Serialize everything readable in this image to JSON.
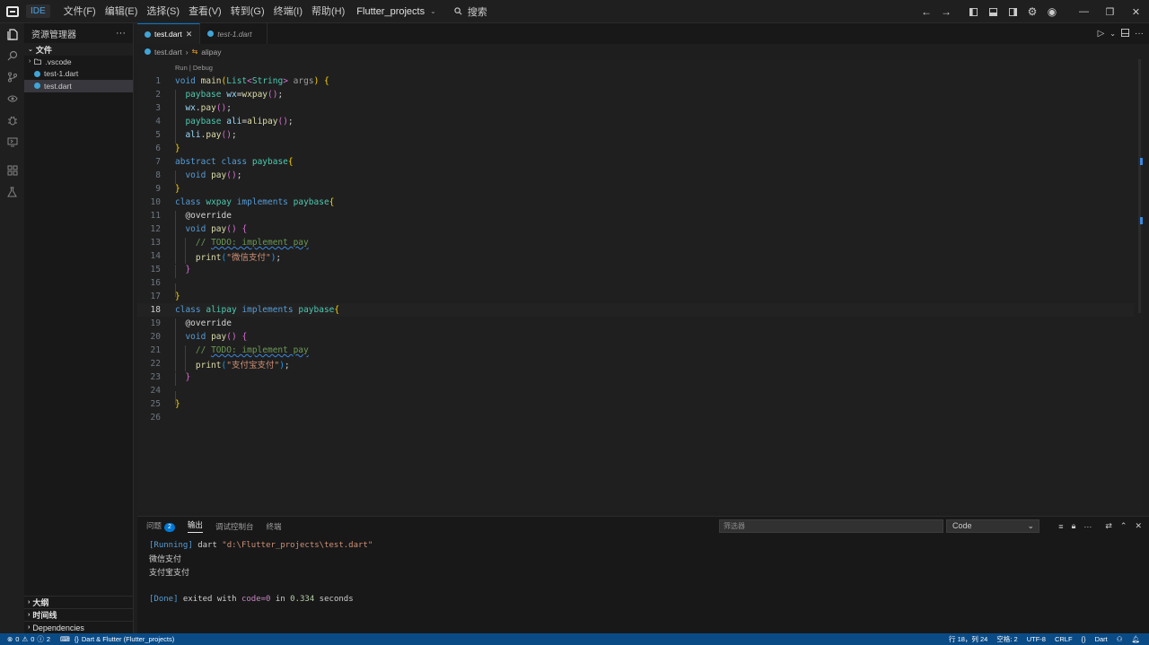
{
  "titlebar": {
    "badge": "IDE",
    "menu": [
      "文件(F)",
      "编辑(E)",
      "选择(S)",
      "查看(V)",
      "转到(G)",
      "终端(I)",
      "帮助(H)"
    ],
    "project": "Flutter_projects",
    "search_placeholder": "搜索"
  },
  "sidebar": {
    "title": "资源管理器",
    "section": "文件",
    "items": [
      ".vscode",
      "test-1.dart",
      "test.dart"
    ],
    "bottom_sections": [
      "大纲",
      "时间线",
      "Dependencies"
    ]
  },
  "tabs": [
    {
      "label": "test.dart",
      "active": true
    },
    {
      "label": "test-1.dart",
      "active": false
    }
  ],
  "breadcrumb": {
    "file": "test.dart",
    "symbol": "alipay"
  },
  "editor": {
    "codelens": "Run | Debug",
    "line_numbers": [
      "1",
      "2",
      "3",
      "4",
      "5",
      "6",
      "7",
      "8",
      "9",
      "10",
      "11",
      "12",
      "13",
      "14",
      "15",
      "16",
      "17",
      "18",
      "19",
      "20",
      "21",
      "22",
      "23",
      "24",
      "25",
      "26"
    ],
    "current_line": "18"
  },
  "panel": {
    "tabs": [
      "问题",
      "输出",
      "调试控制台",
      "终端"
    ],
    "problems_count": "2",
    "filter_placeholder": "筛选器",
    "channel": "Code",
    "output": {
      "running_tag": "[Running]",
      "running_cmd": " dart ",
      "running_path": "\"d:\\Flutter_projects\\test.dart\"",
      "line2": "微信支付",
      "line3": "支付宝支付",
      "done_tag": "[Done]",
      "done_text_1": " exited with ",
      "done_code": "code=0",
      "done_text_2": " in ",
      "done_time": "0.334",
      "done_text_3": " seconds"
    }
  },
  "statusbar": {
    "errors": "0",
    "warnings": "0",
    "infos": "2",
    "flutter": "Dart & Flutter (Flutter_projects)",
    "position": "行 18，列 24",
    "spaces": "空格: 2",
    "encoding": "UTF-8",
    "eol": "CRLF",
    "braces": "{}",
    "language": "Dart"
  },
  "colors": {
    "accent": "#0078d4",
    "statusbar": "#0a4b86",
    "editor_bg": "#1f1f1f",
    "dart": "#40a4d8"
  }
}
